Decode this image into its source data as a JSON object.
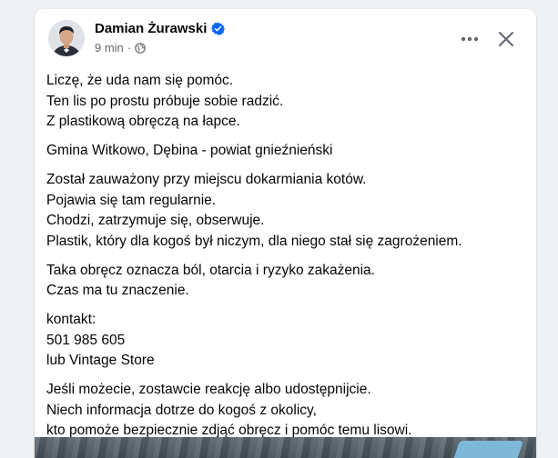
{
  "post": {
    "author": "Damian Żurawski",
    "time": "9 min",
    "separator": "·",
    "paragraphs": [
      [
        "Liczę, że uda nam się pomóc.",
        "Ten lis po prostu próbuje sobie radzić.",
        "Z plastikową obręczą na łapce."
      ],
      [
        "Gmina Witkowo, Dębina - powiat gnieźnieński"
      ],
      [
        "Został zauważony przy miejscu dokarmiania kotów.",
        "Pojawia się tam regularnie.",
        "Chodzi, zatrzymuje się, obserwuje.",
        "Plastik, który dla kogoś był niczym, dla niego stał się zagrożeniem."
      ],
      [
        "Taka obręcz oznacza ból, otarcia i ryzyko zakażenia.",
        "Czas ma tu znaczenie."
      ],
      [
        "kontakt:",
        "501 985 605",
        "lub Vintage Store"
      ],
      [
        "Jeśli możecie, zostawcie reakcję albo udostępnijcie.",
        "Niech informacja dotrze do kogoś z okolicy,",
        "kto pomoże bezpiecznie zdjąć obręcz i pomóc temu lisowi."
      ]
    ]
  },
  "icons": {
    "verified": "verified-badge-icon",
    "audience": "globe-icon",
    "more": "more-options-icon",
    "close": "close-icon"
  },
  "colors": {
    "verified_blue": "#0866ff",
    "secondary_text": "#65676b",
    "primary_text": "#050505",
    "page_bg": "#eef0f3"
  }
}
